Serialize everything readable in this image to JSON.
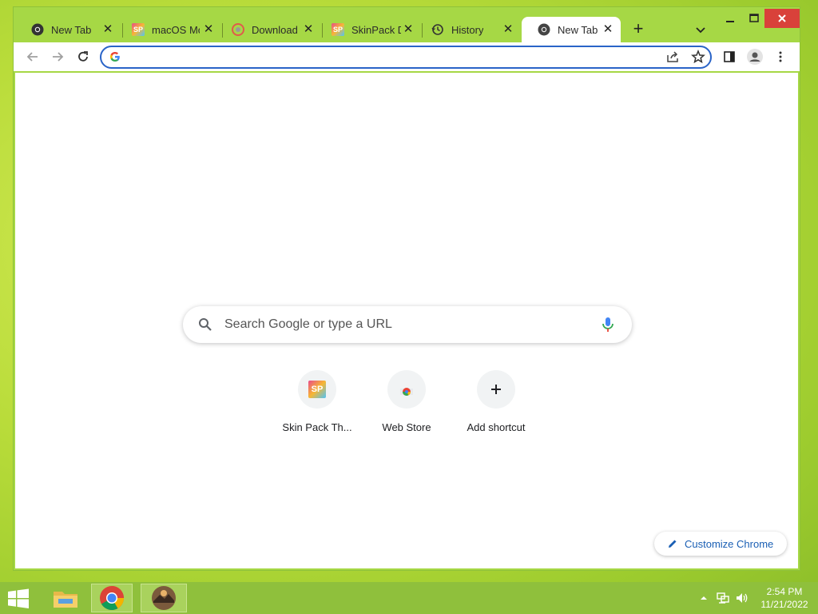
{
  "browser": {
    "tabs": [
      {
        "label": "New Tab",
        "icon": "chrome-icon"
      },
      {
        "label": "macOS Mo",
        "icon": "skinpack-icon"
      },
      {
        "label": "Download",
        "icon": "download-site-icon"
      },
      {
        "label": "SkinPack D",
        "icon": "skinpack-icon"
      },
      {
        "label": "History",
        "icon": "history-icon"
      },
      {
        "label": "New Tab",
        "icon": "chrome-icon",
        "active": true
      }
    ],
    "new_tab_symbol": "+",
    "close_symbol": "✕",
    "omnibox": {
      "value": "",
      "placeholder": ""
    }
  },
  "ntp": {
    "search_placeholder": "Search Google or type a URL",
    "shortcuts": [
      {
        "label": "Skin Pack Th...",
        "icon": "skinpack-icon"
      },
      {
        "label": "Web Store",
        "icon": "web-store-icon"
      },
      {
        "label": "Add shortcut",
        "icon": "plus-icon"
      }
    ],
    "customize_label": "Customize Chrome"
  },
  "taskbar": {
    "time": "2:54 PM",
    "date": "11/21/2022"
  },
  "colors": {
    "accent": "#1a73e8",
    "frame": "#a6d845",
    "close_red": "#d9413a"
  }
}
